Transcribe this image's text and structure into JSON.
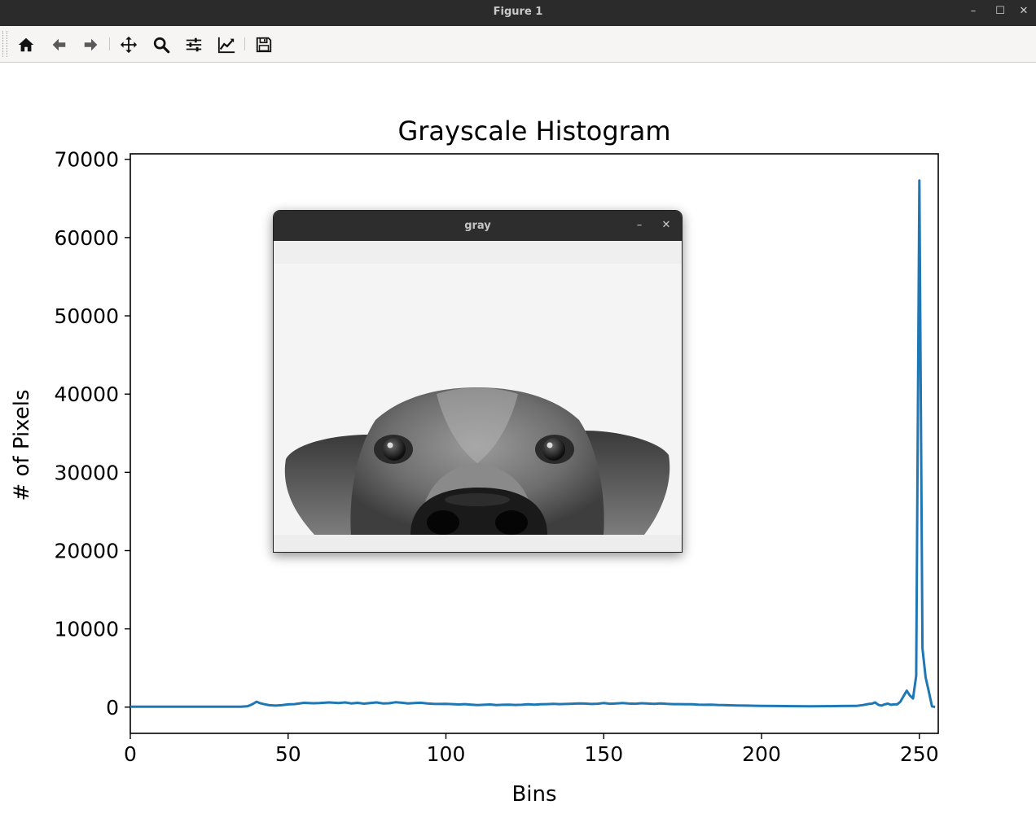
{
  "window": {
    "title": "Figure 1",
    "minimize": "–",
    "maximize": "☐",
    "close": "✕"
  },
  "toolbar": {
    "items": [
      {
        "name": "home-button",
        "icon": "home-icon"
      },
      {
        "name": "back-button",
        "icon": "arrow-left-icon"
      },
      {
        "name": "forward-button",
        "icon": "arrow-right-icon"
      },
      {
        "name": "pan-button",
        "icon": "move-icon"
      },
      {
        "name": "zoom-button",
        "icon": "search-icon"
      },
      {
        "name": "subplots-button",
        "icon": "sliders-icon"
      },
      {
        "name": "edit-axis-button",
        "icon": "line-chart-icon"
      },
      {
        "name": "save-button",
        "icon": "floppy-disk-icon"
      }
    ]
  },
  "gray_window": {
    "title": "gray",
    "minimize": "–",
    "close": "✕",
    "image": "grayscale-dog-photo"
  },
  "chart_data": {
    "type": "line",
    "title": "Grayscale Histogram",
    "xlabel": "Bins",
    "ylabel": "# of Pixels",
    "xlim": [
      0,
      256
    ],
    "ylim": [
      -3350,
      70700
    ],
    "xticks": [
      0,
      50,
      100,
      150,
      200,
      250
    ],
    "yticks": [
      0,
      10000,
      20000,
      30000,
      40000,
      50000,
      60000,
      70000
    ],
    "color": "#1f77b4",
    "grid": false,
    "series": [
      {
        "points": [
          [
            0,
            50
          ],
          [
            10,
            50
          ],
          [
            20,
            50
          ],
          [
            30,
            50
          ],
          [
            35,
            60
          ],
          [
            37,
            100
          ],
          [
            38,
            250
          ],
          [
            39,
            450
          ],
          [
            40,
            700
          ],
          [
            41,
            520
          ],
          [
            42,
            420
          ],
          [
            44,
            250
          ],
          [
            46,
            200
          ],
          [
            48,
            250
          ],
          [
            50,
            350
          ],
          [
            52,
            380
          ],
          [
            55,
            550
          ],
          [
            58,
            500
          ],
          [
            60,
            520
          ],
          [
            63,
            600
          ],
          [
            66,
            520
          ],
          [
            68,
            600
          ],
          [
            70,
            480
          ],
          [
            72,
            550
          ],
          [
            74,
            450
          ],
          [
            76,
            520
          ],
          [
            78,
            600
          ],
          [
            80,
            480
          ],
          [
            82,
            500
          ],
          [
            84,
            620
          ],
          [
            86,
            560
          ],
          [
            88,
            480
          ],
          [
            90,
            520
          ],
          [
            92,
            560
          ],
          [
            94,
            480
          ],
          [
            96,
            420
          ],
          [
            98,
            400
          ],
          [
            100,
            420
          ],
          [
            102,
            380
          ],
          [
            104,
            340
          ],
          [
            106,
            380
          ],
          [
            108,
            320
          ],
          [
            110,
            260
          ],
          [
            112,
            300
          ],
          [
            114,
            340
          ],
          [
            116,
            260
          ],
          [
            118,
            300
          ],
          [
            120,
            320
          ],
          [
            122,
            280
          ],
          [
            124,
            300
          ],
          [
            126,
            360
          ],
          [
            128,
            320
          ],
          [
            130,
            360
          ],
          [
            132,
            380
          ],
          [
            134,
            420
          ],
          [
            136,
            380
          ],
          [
            138,
            400
          ],
          [
            140,
            440
          ],
          [
            142,
            480
          ],
          [
            144,
            460
          ],
          [
            146,
            400
          ],
          [
            148,
            440
          ],
          [
            150,
            520
          ],
          [
            152,
            440
          ],
          [
            154,
            480
          ],
          [
            156,
            520
          ],
          [
            158,
            460
          ],
          [
            160,
            440
          ],
          [
            162,
            500
          ],
          [
            164,
            460
          ],
          [
            166,
            420
          ],
          [
            168,
            480
          ],
          [
            170,
            420
          ],
          [
            172,
            380
          ],
          [
            174,
            380
          ],
          [
            176,
            360
          ],
          [
            178,
            360
          ],
          [
            180,
            320
          ],
          [
            182,
            300
          ],
          [
            184,
            320
          ],
          [
            186,
            280
          ],
          [
            188,
            260
          ],
          [
            190,
            240
          ],
          [
            192,
            220
          ],
          [
            195,
            200
          ],
          [
            198,
            180
          ],
          [
            200,
            160
          ],
          [
            205,
            140
          ],
          [
            210,
            120
          ],
          [
            215,
            110
          ],
          [
            220,
            120
          ],
          [
            225,
            140
          ],
          [
            230,
            160
          ],
          [
            232,
            260
          ],
          [
            234,
            400
          ],
          [
            235,
            450
          ],
          [
            236,
            600
          ],
          [
            237,
            300
          ],
          [
            238,
            200
          ],
          [
            239,
            350
          ],
          [
            240,
            450
          ],
          [
            241,
            300
          ],
          [
            242,
            350
          ],
          [
            243,
            350
          ],
          [
            244,
            700
          ],
          [
            245,
            1400
          ],
          [
            246,
            2100
          ],
          [
            247,
            1500
          ],
          [
            248,
            1100
          ],
          [
            249,
            4000
          ],
          [
            250,
            67300
          ],
          [
            251,
            7500
          ],
          [
            252,
            3800
          ],
          [
            253,
            2000
          ],
          [
            254,
            100
          ],
          [
            255,
            20
          ]
        ]
      }
    ]
  }
}
